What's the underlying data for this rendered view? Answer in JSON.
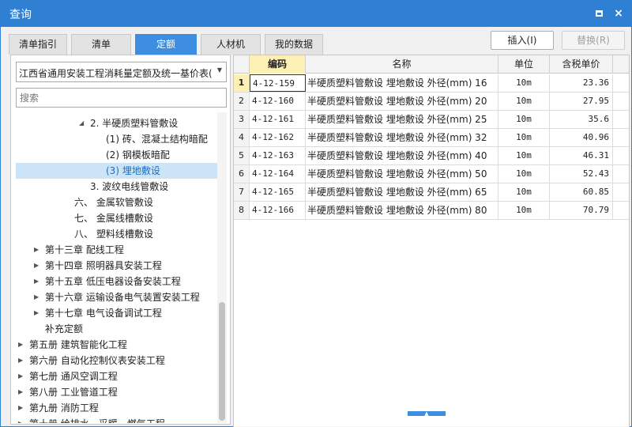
{
  "window": {
    "title": "查询",
    "maximize_glyph": "□",
    "close_glyph": "×"
  },
  "tabs": [
    {
      "label": "清单指引",
      "active": false
    },
    {
      "label": "清单",
      "active": false
    },
    {
      "label": "定额",
      "active": true
    },
    {
      "label": "人材机",
      "active": false
    },
    {
      "label": "我的数据",
      "active": false
    }
  ],
  "toolbar": {
    "insert_label": "插入(I)",
    "replace_label": "替换(R)"
  },
  "library_select": {
    "value": "江西省通用安装工程消耗量定额及统一基价表("
  },
  "search": {
    "placeholder": "搜索"
  },
  "tree": [
    {
      "label": "2. 半硬质塑料管敷设",
      "depth": 3,
      "toggle": "◢",
      "selected": false
    },
    {
      "label": "(1) 砖、混凝土结构暗配",
      "depth": 5,
      "toggle": "",
      "selected": false
    },
    {
      "label": "(2) 钢模板暗配",
      "depth": 5,
      "toggle": "",
      "selected": false
    },
    {
      "label": "(3) 埋地敷设",
      "depth": 5,
      "toggle": "",
      "selected": true
    },
    {
      "label": "3. 波纹电线管敷设",
      "depth": 3,
      "toggle": "",
      "selected": false
    },
    {
      "label": "六、 金属软管敷设",
      "depth": 2,
      "toggle": "",
      "selected": false
    },
    {
      "label": "七、 金属线槽敷设",
      "depth": 2,
      "toggle": "",
      "selected": false
    },
    {
      "label": "八、 塑料线槽敷设",
      "depth": 2,
      "toggle": "",
      "selected": false
    },
    {
      "label": "第十三章 配线工程",
      "depth": 1,
      "toggle": "▶",
      "selected": false
    },
    {
      "label": "第十四章 照明器具安装工程",
      "depth": 1,
      "toggle": "▶",
      "selected": false
    },
    {
      "label": "第十五章 低压电器设备安装工程",
      "depth": 1,
      "toggle": "▶",
      "selected": false
    },
    {
      "label": "第十六章 运输设备电气装置安装工程",
      "depth": 1,
      "toggle": "▶",
      "selected": false
    },
    {
      "label": "第十七章 电气设备调试工程",
      "depth": 1,
      "toggle": "▶",
      "selected": false
    },
    {
      "label": "补充定额",
      "depth": 1,
      "toggle": "",
      "selected": false
    },
    {
      "label": "第五册 建筑智能化工程",
      "depth": 0,
      "toggle": "▶",
      "selected": false
    },
    {
      "label": "第六册 自动化控制仪表安装工程",
      "depth": 0,
      "toggle": "▶",
      "selected": false
    },
    {
      "label": "第七册 通风空调工程",
      "depth": 0,
      "toggle": "▶",
      "selected": false
    },
    {
      "label": "第八册 工业管道工程",
      "depth": 0,
      "toggle": "▶",
      "selected": false
    },
    {
      "label": "第九册 消防工程",
      "depth": 0,
      "toggle": "▶",
      "selected": false
    },
    {
      "label": "第十册 给排水、采暖、燃气工程",
      "depth": 0,
      "toggle": "▶",
      "selected": false
    }
  ],
  "grid": {
    "columns": [
      "编码",
      "名称",
      "单位",
      "含税单价"
    ],
    "active_column": 0,
    "active_row": 0,
    "rows": [
      {
        "no": "1",
        "code": "4-12-159",
        "name": "半硬质塑料管敷设 埋地敷设 外径(mm) 16",
        "unit": "10m",
        "price": "23.36"
      },
      {
        "no": "2",
        "code": "4-12-160",
        "name": "半硬质塑料管敷设 埋地敷设 外径(mm) 20",
        "unit": "10m",
        "price": "27.95"
      },
      {
        "no": "3",
        "code": "4-12-161",
        "name": "半硬质塑料管敷设 埋地敷设 外径(mm) 25",
        "unit": "10m",
        "price": "35.6"
      },
      {
        "no": "4",
        "code": "4-12-162",
        "name": "半硬质塑料管敷设 埋地敷设 外径(mm) 32",
        "unit": "10m",
        "price": "40.96"
      },
      {
        "no": "5",
        "code": "4-12-163",
        "name": "半硬质塑料管敷设 埋地敷设 外径(mm) 40",
        "unit": "10m",
        "price": "46.31"
      },
      {
        "no": "6",
        "code": "4-12-164",
        "name": "半硬质塑料管敷设 埋地敷设 外径(mm) 50",
        "unit": "10m",
        "price": "52.43"
      },
      {
        "no": "7",
        "code": "4-12-165",
        "name": "半硬质塑料管敷设 埋地敷设 外径(mm) 65",
        "unit": "10m",
        "price": "60.85"
      },
      {
        "no": "8",
        "code": "4-12-166",
        "name": "半硬质塑料管敷设 埋地敷设 外径(mm) 80",
        "unit": "10m",
        "price": "70.79"
      }
    ]
  },
  "icons": {
    "tree_collapsed": "caret-right-icon",
    "tree_expanded": "caret-down-icon",
    "dropdown": "chevron-down-icon",
    "splitter": "chevron-up-icon"
  },
  "colors": {
    "accent": "#2f7fd3",
    "active_tab": "#3d8ee0",
    "selection": "#cce4f7",
    "active_header": "#fdf0b4"
  }
}
